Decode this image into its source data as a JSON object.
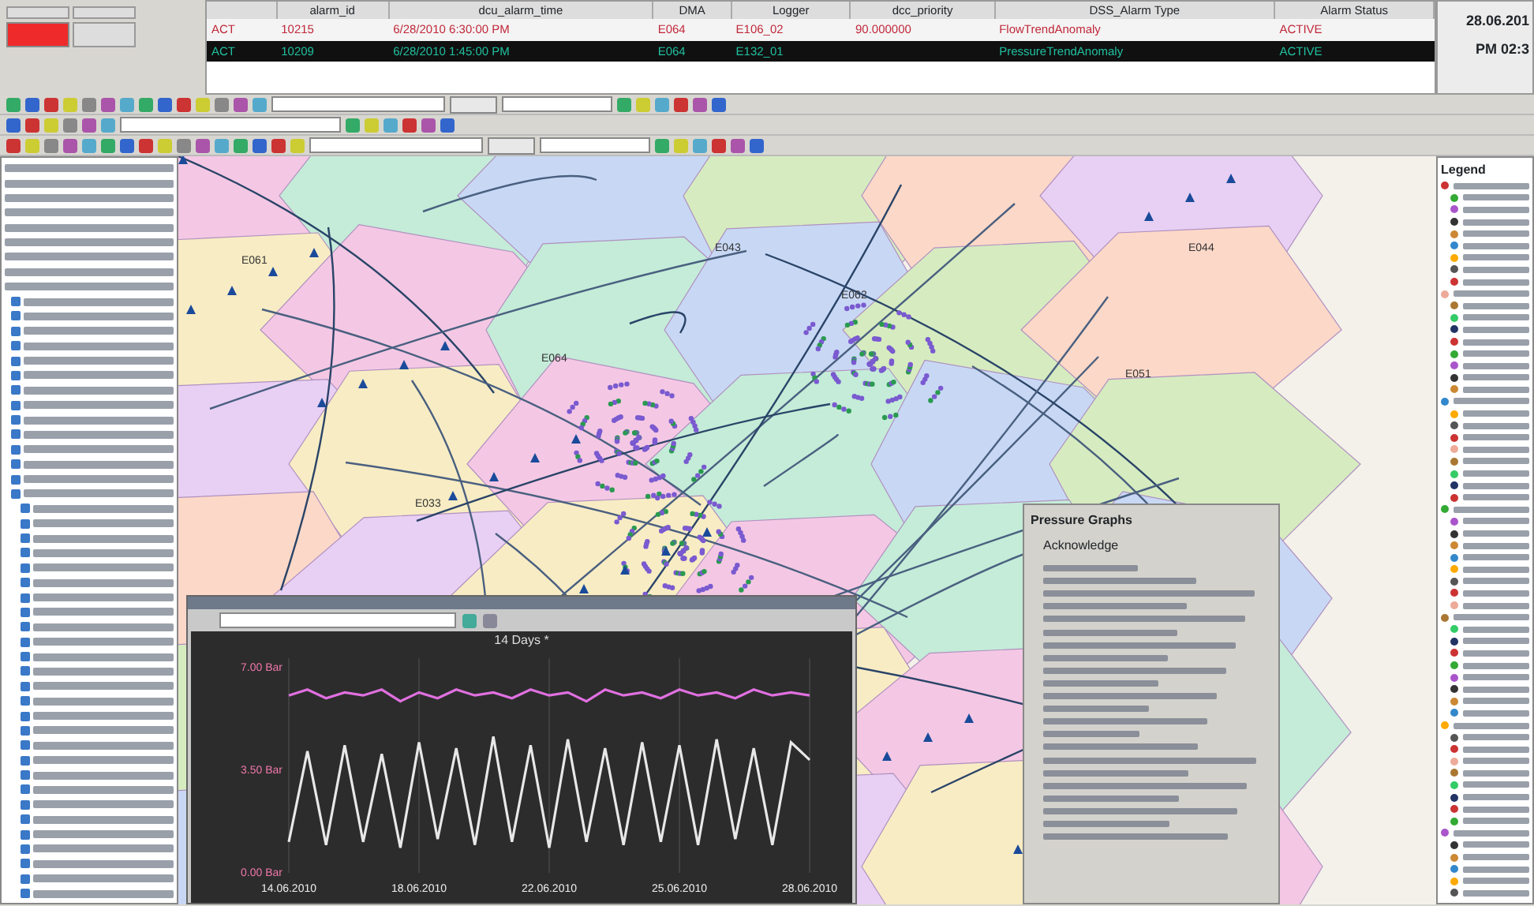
{
  "alarm_table": {
    "columns": [
      "alarm_id",
      "dcu_alarm_time",
      "DMA",
      "Logger",
      "dcc_priority",
      "DSS_Alarm Type",
      "Alarm Status"
    ],
    "rows": [
      {
        "selected": false,
        "code": "ACT",
        "alarm_id": "10215",
        "time": "6/28/2010 6:30:00 PM",
        "dma": "E064",
        "logger": "E106_02",
        "priority": "90.000000",
        "type": "FlowTrendAnomaly",
        "status": "ACTIVE"
      },
      {
        "selected": true,
        "code": "ACT",
        "alarm_id": "10209",
        "time": "6/28/2010 1:45:00 PM",
        "dma": "E064",
        "logger": "E132_01",
        "type": "PressureTrendAnomaly",
        "status": "ACTIVE"
      }
    ]
  },
  "clock": {
    "date": "28.06.201",
    "time": "PM 02:3"
  },
  "map": {
    "labels": [
      "E064",
      "E061",
      "E062",
      "E033",
      "E043",
      "E051",
      "E044"
    ]
  },
  "trend_window": {
    "chart_data": {
      "type": "line",
      "title": "14 Days *",
      "categories": [
        "14.06.2010",
        null,
        null,
        null,
        null,
        null,
        null,
        "18.06.2010",
        null,
        null,
        null,
        null,
        null,
        null,
        "22.06.2010",
        null,
        null,
        null,
        null,
        null,
        null,
        "25.06.2010",
        null,
        null,
        null,
        null,
        null,
        null,
        "28.06.2010"
      ],
      "ylim": [
        0,
        7
      ],
      "grid": true,
      "yticks": [
        {
          "value": 7,
          "label": "7.00 Bar"
        },
        {
          "value": 3.5,
          "label": "3.50 Bar"
        },
        {
          "value": 0,
          "label": "0.00 Bar"
        }
      ],
      "series": [
        {
          "color": "#e070e0",
          "values": [
            6.0,
            6.2,
            5.9,
            6.1,
            6.0,
            6.2,
            5.8,
            6.1,
            5.9,
            6.2,
            6.0,
            6.1,
            5.9,
            6.2,
            6.0,
            6.1,
            5.8,
            6.2,
            6.0,
            6.1,
            5.9,
            6.2,
            6.0,
            6.1,
            5.9,
            6.2,
            6.0,
            6.1,
            6.0
          ]
        },
        {
          "color": "#e8e8e8",
          "values": [
            1.0,
            4.1,
            0.9,
            4.3,
            1.0,
            4.0,
            0.8,
            4.4,
            1.1,
            4.2,
            0.9,
            4.6,
            1.0,
            4.3,
            0.8,
            4.5,
            1.0,
            4.2,
            0.9,
            4.4,
            1.0,
            4.3,
            0.9,
            4.5,
            1.1,
            4.2,
            0.9,
            4.4,
            3.8
          ]
        }
      ]
    }
  },
  "context_menu": {
    "items": [
      {
        "kind": "header",
        "label": "Pressure Graphs"
      },
      {
        "kind": "item",
        "label": "Acknowledge"
      }
    ]
  },
  "legend": {
    "title": "Legend"
  }
}
